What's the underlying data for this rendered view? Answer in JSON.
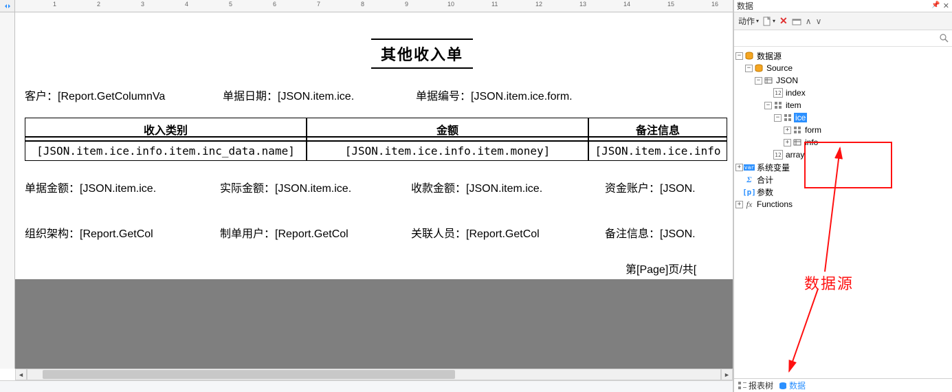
{
  "panel": {
    "title": "数据",
    "actions_label": "动作",
    "search_placeholder": ""
  },
  "tree": {
    "root": "数据源",
    "source": "Source",
    "json": "JSON",
    "index": "index",
    "item": "item",
    "ice": "ice",
    "form": "form",
    "info": "info",
    "array": "array",
    "sysvars": "系统变量",
    "totals": "合计",
    "params": "参数",
    "functions": "Functions"
  },
  "tabs": {
    "tree_tab": "报表树",
    "data_tab": "数据"
  },
  "annotation": "数据源",
  "report": {
    "title": "其他收入单",
    "customer_label": "客户：",
    "customer_value": "[Report.GetColumnVa",
    "doc_date_label": "单据日期：",
    "doc_date_value": "[JSON.item.ice.",
    "doc_no_label": "单据编号：",
    "doc_no_value": "[JSON.item.ice.form.",
    "col1": "收入类别",
    "col2": "金额",
    "col3": "备注信息",
    "row_col1": "[JSON.item.ice.info.item.inc_data.name]",
    "row_col2": "[JSON.item.ice.info.item.money]",
    "row_col3": "[JSON.item.ice.info",
    "doc_amt_label": "单据金额：",
    "doc_amt_value": "[JSON.item.ice.",
    "actual_amt_label": "实际金额：",
    "actual_amt_value": "[JSON.item.ice.",
    "receipt_amt_label": "收款金额：",
    "receipt_amt_value": "[JSON.item.ice.",
    "fund_acct_label": "资金账户：",
    "fund_acct_value": "[JSON.",
    "org_label": "组织架构：",
    "org_value": "[Report.GetCol",
    "maker_label": "制单用户：",
    "maker_value": "[Report.GetCol",
    "related_label": "关联人员：",
    "related_value": "[Report.GetCol",
    "remark_label": "备注信息：",
    "remark_value": "[JSON.",
    "pager": "第[Page]页/共["
  },
  "ruler": {
    "n1": "1",
    "n2": "2",
    "n3": "3",
    "n4": "4",
    "n5": "5",
    "n6": "6",
    "n7": "7",
    "n8": "8",
    "n9": "9",
    "n10": "10",
    "n11": "11",
    "n12": "12",
    "n13": "13",
    "n14": "14",
    "n15": "15",
    "n16": "16"
  }
}
